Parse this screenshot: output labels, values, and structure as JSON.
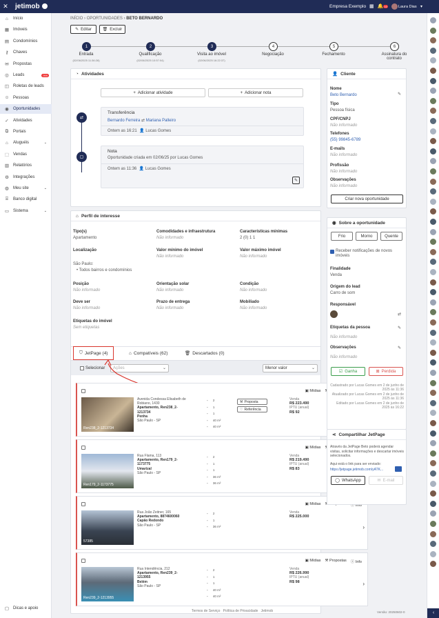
{
  "topbar": {
    "logo": "jetimob",
    "company": "Empresa Exemplo",
    "user": "Laura Dias",
    "notif_count": "10"
  },
  "sidebar": {
    "items": [
      {
        "label": "Início",
        "icon": "home-icon"
      },
      {
        "label": "Imóveis",
        "icon": "building-icon"
      },
      {
        "label": "Condomínios",
        "icon": "condo-icon"
      },
      {
        "label": "Chaves",
        "icon": "key-icon"
      },
      {
        "label": "Propostas",
        "icon": "proposal-icon"
      },
      {
        "label": "Leads",
        "icon": "leads-icon",
        "count": "999"
      },
      {
        "label": "Roletas de leads",
        "icon": "roulette-icon"
      },
      {
        "label": "Pessoas",
        "icon": "people-icon"
      },
      {
        "label": "Oportunidades",
        "icon": "opportunity-icon",
        "active": true
      },
      {
        "label": "Atividades",
        "icon": "activity-icon"
      },
      {
        "label": "Portais",
        "icon": "portal-icon"
      },
      {
        "label": "Aluguéis",
        "icon": "rent-icon",
        "chevron": true
      },
      {
        "label": "Vendas",
        "icon": "sale-icon"
      },
      {
        "label": "Relatórios",
        "icon": "report-icon"
      },
      {
        "label": "Integrações",
        "icon": "integration-icon"
      },
      {
        "label": "Meu site",
        "icon": "site-icon",
        "chevron": true
      },
      {
        "label": "Banco digital",
        "icon": "bank-icon"
      },
      {
        "label": "Sistema",
        "icon": "system-icon",
        "chevron": true
      }
    ],
    "footer": "Dicas e apoio"
  },
  "breadcrumb": {
    "a": "INÍCIO",
    "b": "OPORTUNIDADES",
    "c": "BETO BERNARDO"
  },
  "actions": {
    "edit": "Editar",
    "delete": "Excluir"
  },
  "steps": [
    {
      "n": "1",
      "name": "Entrada",
      "date": "(02/06/2025 11:36:28)",
      "done": true
    },
    {
      "n": "2",
      "name": "Qualificação",
      "date": "(02/06/2025 10:57:04)",
      "done": true
    },
    {
      "n": "3",
      "name": "Visita ao imóvel",
      "date": "(02/06/2025 16:22:37)",
      "done": true
    },
    {
      "n": "4",
      "name": "Negociação",
      "date": "",
      "done": false
    },
    {
      "n": "5",
      "name": "Fechamento",
      "date": "",
      "done": false
    },
    {
      "n": "6",
      "name": "Assinatura do contrato",
      "date": "",
      "done": false
    }
  ],
  "activities": {
    "title": "Atividades",
    "add_activity": "Adicionar atividade",
    "add_note": "Adicionar nota",
    "transfer_title": "Transferência",
    "transfer_from": "Bernardo Ferreira",
    "transfer_to": "Mariana Palleiro",
    "transfer_meta": "Ontem as 16:21",
    "transfer_user": "Lucas Gomes",
    "note_title": "Nota",
    "note_text": "Oportunidade criada em 02/06/25 por Lucas Gomes",
    "note_meta": "Ontem as 11:36",
    "note_user": "Lucas Gomes"
  },
  "profile": {
    "title": "Perfil de interesse",
    "fields": [
      {
        "label": "Tipo(s)",
        "value": "Apartamento"
      },
      {
        "label": "Comodidades e infraestrutura",
        "value": "Não informado",
        "muted": true
      },
      {
        "label": "Características mínimas",
        "value": "2 (0) 1 1"
      },
      {
        "label": "Localização",
        "value": "São Paulo:"
      },
      {
        "label": "Valor mínimo do imóvel",
        "value": "Não informado",
        "muted": true
      },
      {
        "label": "Valor máximo imóvel",
        "value": "Não informado",
        "muted": true
      },
      {
        "label": "Posição",
        "value": "Não informado",
        "muted": true
      },
      {
        "label": "Orientação solar",
        "value": "Não informado",
        "muted": true
      },
      {
        "label": "Condição",
        "value": "Não informado",
        "muted": true
      },
      {
        "label": "Deve ser",
        "value": "Não informado",
        "muted": true
      },
      {
        "label": "Prazo de entrega",
        "value": "Não informado",
        "muted": true
      },
      {
        "label": "Mobiliado",
        "value": "Não informado",
        "muted": true
      },
      {
        "label": "Etiquetas do imóvel",
        "value": "Sem etiquetas",
        "muted": true
      }
    ],
    "loc_city": "São Paulo:",
    "loc_all": "Todos bairros e condomínios"
  },
  "tabs": [
    {
      "label": "JetPage (4)",
      "icon": "jetpage-icon"
    },
    {
      "label": "Compatíveis (62)",
      "icon": "house-icon"
    },
    {
      "label": "Descartados (0)",
      "icon": "trash-icon"
    }
  ],
  "listbar": {
    "select": "Selecionar",
    "actions": "Ações",
    "sort": "Menor valor"
  },
  "properties": [
    {
      "street": "Avenida Condessa Elisabeth de Robiano, 1430",
      "type": "Apartamento, Ren238_2-1213734",
      "hood": "Penha",
      "city": "São Paulo - SP",
      "code": "Ren238_2-1213734",
      "specs": [
        "2",
        "1",
        "1",
        "40 m²",
        "40 m²"
      ],
      "venda": "Venda",
      "price": "R$ 223.490",
      "iptu": "IPTU (anual)",
      "iptu_val": "R$ 92",
      "proposal": "Proposta",
      "reference": "Referência"
    },
    {
      "street": "Rua Flama, 113",
      "type": "Apartamento, Ren179_2-1173775",
      "hood": "Umarizal",
      "city": "São Paulo - SP",
      "code": "Ren179_2-1173775",
      "specs": [
        "2",
        "1",
        "1",
        "36 m²",
        "36 m²"
      ],
      "venda": "Venda",
      "price": "R$ 219.490",
      "iptu": "IPTU (anual)",
      "iptu_val": "R$ 83"
    },
    {
      "street": "Rua João Zeitner, 165",
      "type": "Apartamento, 8874600060",
      "hood": "Capão Redondo",
      "city": "São Paulo - SP",
      "code": "57385",
      "specs": [
        "2",
        "1",
        "36 m²"
      ],
      "venda": "Venda",
      "price": "R$ 225.000"
    },
    {
      "street": "Rua Intendência, 212",
      "type": "Apartamento, Ren239_2-1213955",
      "hood": "Belém",
      "city": "São Paulo - SP",
      "code": "Ren239_2-1213955",
      "specs": [
        "2",
        "1",
        "1",
        "40 m²",
        "40 m²"
      ],
      "venda": "Venda",
      "price": "R$ 226.990",
      "iptu": "IPTU (anual)",
      "iptu_val": "R$ 98"
    }
  ],
  "prop_actions": {
    "media": "Mídias",
    "proposals": "Propostas",
    "info": "Info"
  },
  "client": {
    "title": "Cliente",
    "name_label": "Nome",
    "name": "Beto Bernardo",
    "type_label": "Tipo",
    "type": "Pessoa física",
    "cpf_label": "CPF/CNPJ",
    "cpf": "Não informado",
    "phone_label": "Telefones",
    "phone": "(55) 99845-6789",
    "email_label": "E-mails",
    "email": "Não informado",
    "job_label": "Profissão",
    "job": "Não informado",
    "obs_label": "Observações",
    "obs": "Não informado",
    "new_btn": "Criar nova oportunidade"
  },
  "about": {
    "title": "Sobre a oportunidade",
    "temps": [
      "Frio",
      "Morno",
      "Quente"
    ],
    "notif": "Receber notificações de novos imóveis",
    "purpose_label": "Finalidade",
    "purpose": "Venda",
    "origin_label": "Origem do lead",
    "origin": "Carro de som",
    "resp_label": "Responsável",
    "tags_label": "Etiquetas da pessoa",
    "tags": "Não informado",
    "obs_label": "Observações",
    "obs": "Não informado",
    "won": "Ganha",
    "lost": "Perdida",
    "audit1": "Cadastrado por Lucas Gomes em 2 de junho de 2025 às 11:36",
    "audit2": "Atualizado por Lucas Gomes em 2 de junho de 2025 às 11:36",
    "audit3": "Editado por Lucas Gomes em 2 de junho de 2025 às 16:22"
  },
  "share": {
    "title": "Compartilhar JetPage",
    "text": "Através da JetPage Beto poderá agendar visitas, solicitar informações e descartar imóveis selecionados.",
    "link_label": "Aqui está o link para ser enviado:",
    "link": "https://jetpage.jetimob.com/yATK...",
    "whatsapp": "WhatsApp",
    "email": "E-mail"
  },
  "footer": {
    "terms": "Termos de Serviço",
    "privacy": "Política de Privacidade",
    "brand": "Jetimob",
    "version": "Versão: 20250602-0"
  }
}
